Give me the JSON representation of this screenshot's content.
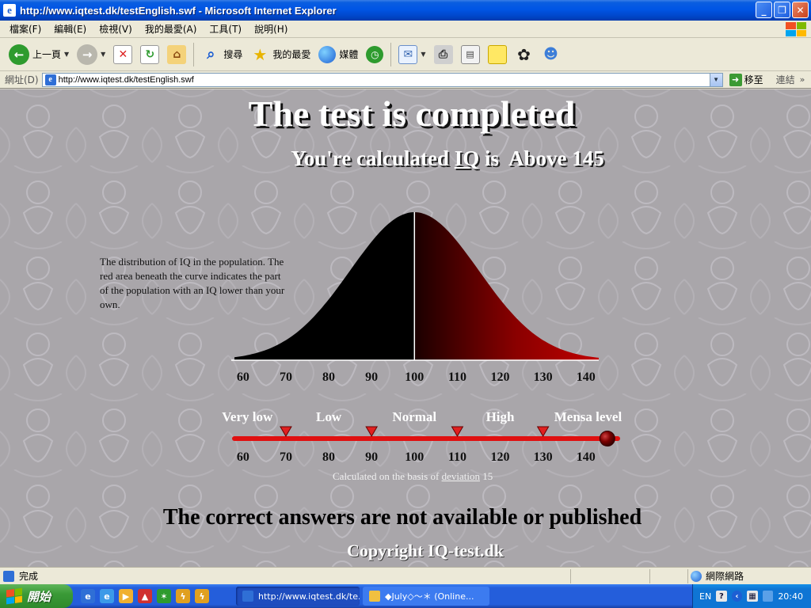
{
  "window": {
    "title": "http://www.iqtest.dk/testEnglish.swf - Microsoft Internet Explorer",
    "minimize_glyph": "_",
    "restore_glyph": "❐",
    "close_glyph": "✕"
  },
  "menu": {
    "items": [
      "檔案(F)",
      "編輯(E)",
      "檢視(V)",
      "我的最愛(A)",
      "工具(T)",
      "說明(H)"
    ]
  },
  "toolbar": {
    "back_label": "上一頁",
    "search_label": "搜尋",
    "favorites_label": "我的最愛",
    "media_label": "媒體"
  },
  "address": {
    "label": "網址(D)",
    "url": "http://www.iqtest.dk/testEnglish.swf",
    "go_label": "移至",
    "links_label": "連結"
  },
  "content": {
    "title": "The test is completed",
    "iq_prefix": "You're calculated",
    "iq_link": "IQ",
    "iq_is": "is",
    "iq_result": "Above 145",
    "distribution_text": "The distribution of IQ in the population. The red area beneath the curve indicates the part of the population with an IQ lower than your own.",
    "basis_prefix": "Calculated on the basis of",
    "basis_link": "deviation",
    "basis_value": "15",
    "answers_notice": "The correct answers are not available or published",
    "copyright": "Copyright IQ-test.dk"
  },
  "chart_data": [
    {
      "type": "area",
      "x_ticks": [
        "60",
        "70",
        "80",
        "90",
        "100",
        "110",
        "120",
        "130",
        "140"
      ],
      "xlim": [
        58,
        143
      ],
      "mean": 100,
      "std_dev": 15,
      "highlight_from": 100,
      "highlight_to": 145,
      "colors": {
        "curve_fill": "#000000",
        "highlight_fill": "#a00000",
        "mean_line": "#ffffff"
      }
    },
    {
      "type": "scale",
      "x_ticks": [
        "60",
        "70",
        "80",
        "90",
        "100",
        "110",
        "120",
        "130",
        "140"
      ],
      "xlim": [
        58,
        143
      ],
      "bands": [
        "Very low",
        "Low",
        "Normal",
        "High",
        "Mensa level"
      ],
      "band_thresholds": [
        70,
        90,
        110,
        130
      ],
      "result_marker": 145,
      "colors": {
        "bar": "#e01010",
        "threshold_marker": "#e02020",
        "result_knob": "#7a0000"
      }
    }
  ],
  "status": {
    "text": "完成",
    "zone": "網際網路"
  },
  "taskbar": {
    "start_label": "開始",
    "tasks": [
      "http://www.iqtest.dk/te...",
      "◆July◇～＊ (Online..."
    ],
    "lang": "EN",
    "help": "?",
    "clock": "20:40"
  }
}
